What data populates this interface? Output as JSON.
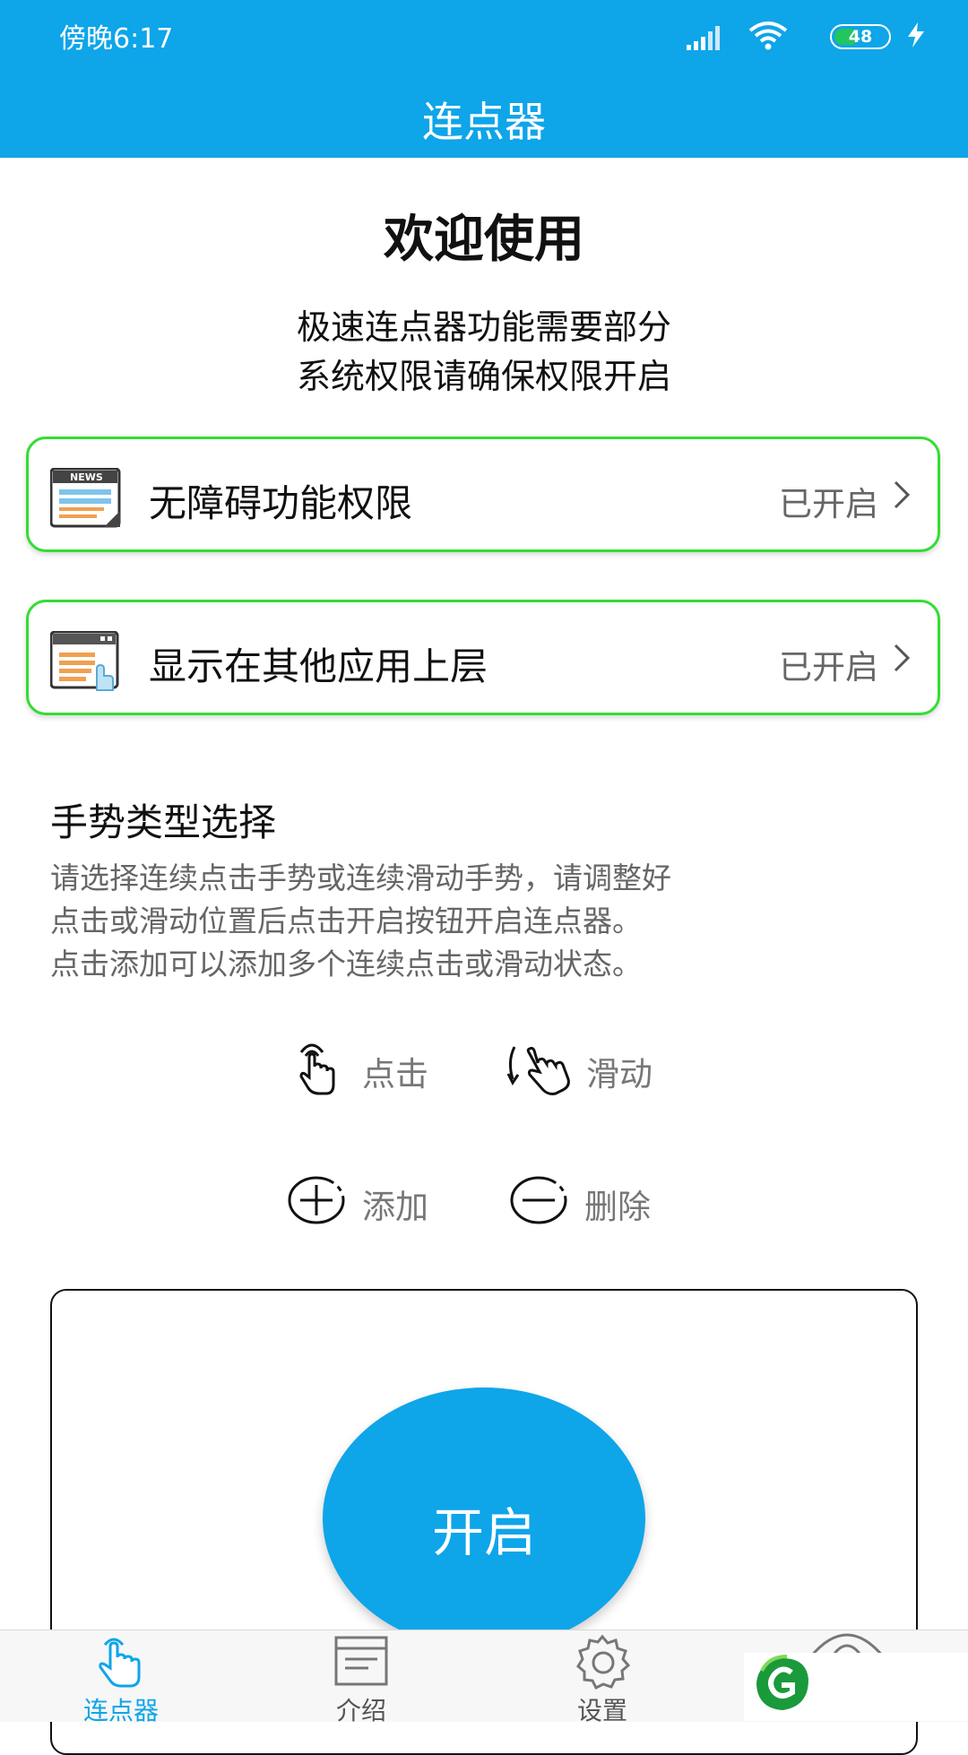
{
  "status_bar": {
    "time": "傍晚6:17",
    "battery": "48",
    "battery_level": 0.48,
    "icons": [
      "signal-icon",
      "wifi-icon",
      "battery-icon",
      "charging-icon"
    ]
  },
  "app_bar": {
    "title": "连点器",
    "color": "#0ea5e9"
  },
  "welcome": {
    "title": "欢迎使用",
    "desc_line1": "极速连点器功能需要部分",
    "desc_line2": "系统权限请确保权限开启"
  },
  "permissions": [
    {
      "icon": "news-icon",
      "label": "无障碍功能权限",
      "status": "已开启"
    },
    {
      "icon": "window-overlay-icon",
      "label": "显示在其他应用上层",
      "status": "已开启"
    }
  ],
  "gesture": {
    "title": "手势类型选择",
    "desc": [
      "请选择连续点击手势或连续滑动手势，请调整好",
      "点击或滑动位置后点击开启按钮开启连点器。",
      "点击添加可以添加多个连续点击或滑动状态。"
    ],
    "options": [
      {
        "icon": "tap-hand-icon",
        "label": "点击"
      },
      {
        "icon": "swipe-hand-icon",
        "label": "滑动"
      },
      {
        "icon": "add-circle-icon",
        "label": "添加"
      },
      {
        "icon": "remove-circle-icon",
        "label": "删除"
      }
    ]
  },
  "start_button": {
    "label": "开启"
  },
  "bottom_nav": [
    {
      "icon": "hand-pointer-icon",
      "label": "连点器",
      "active": true
    },
    {
      "icon": "document-icon",
      "label": "介绍",
      "active": false
    },
    {
      "icon": "gear-icon",
      "label": "设置",
      "active": false
    }
  ],
  "colors": {
    "accent": "#0ea5e9",
    "card_border": "#33dd33",
    "muted_text": "#777777"
  }
}
